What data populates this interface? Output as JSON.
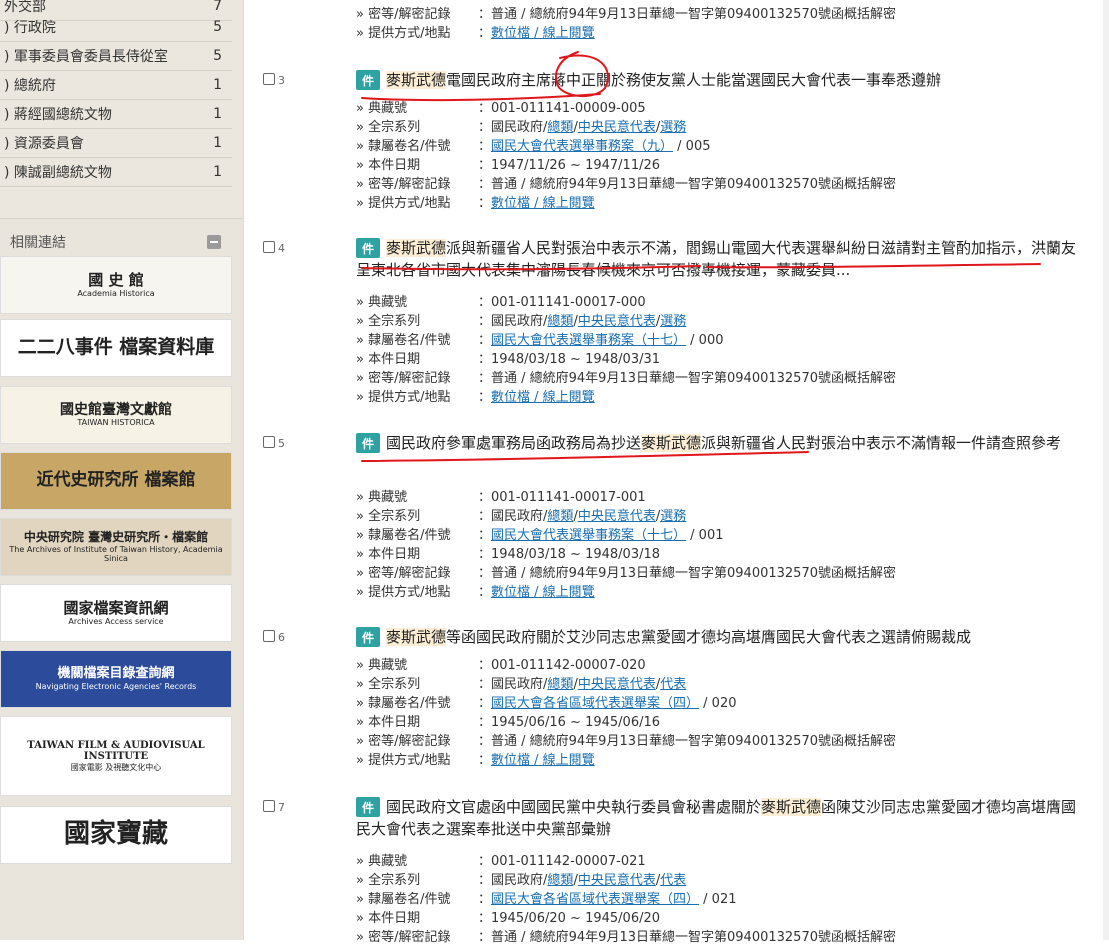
{
  "facets": [
    {
      "label": "外交部",
      "count": "7"
    },
    {
      "label": ") 行政院",
      "count": "5"
    },
    {
      "label": ") 軍事委員會委員長侍從室",
      "count": "5"
    },
    {
      "label": ") 總統府",
      "count": "1"
    },
    {
      "label": ") 蔣經國總統文物",
      "count": "1"
    },
    {
      "label": ") 資源委員會",
      "count": "1"
    },
    {
      "label": ") 陳誠副總統文物",
      "count": "1"
    }
  ],
  "related": {
    "title": "相關連結",
    "banners": [
      {
        "text": "國 史 館",
        "sub": "Academia Historica"
      },
      {
        "text": "二二八事件 檔案資料庫",
        "sub": ""
      },
      {
        "text": "國史館臺灣文獻館",
        "sub": "TAIWAN HISTORICA"
      },
      {
        "text": "近代史研究所 檔案館",
        "sub": ""
      },
      {
        "text": "中央研究院 臺灣史研究所‧檔案館",
        "sub": "The Archives of Institute of Taiwan History, Academia Sinica"
      },
      {
        "text": "國家檔案資訊網",
        "sub": "Archives Access service"
      },
      {
        "text": "機關檔案目錄查詢網",
        "sub": "Navigating Electronic Agencies' Records"
      },
      {
        "text": "TAIWAN FILM & AUDIOVISUAL INSTITUTE",
        "sub": "國家電影 及視聽文化中心"
      },
      {
        "text": "國家寶藏",
        "sub": ""
      }
    ]
  },
  "top_rows": [
    {
      "label": "» 密等/解密記錄",
      "value": "：普通 / 總統府94年9月13日華總一智字第09400132570號函概括解密"
    },
    {
      "label": "» 提供方式/地點",
      "value_pre": "：",
      "link": "數位檔 / 線上閱覽"
    }
  ],
  "results": [
    {
      "num": "3",
      "badge": "件",
      "title_hl": "麥斯武德",
      "title_rest": "電國民政府主席蔣中正關於務使友黨人士能當選國民大會代表一事奉悉遵辦",
      "title_pre": "",
      "ref": "：001-011141-00009-005",
      "series_links": [
        "國民政府",
        "總類",
        "中央民意代表",
        "選務"
      ],
      "volume_link": "國民大會代表選舉事務案（九）",
      "volume_num": " / 005",
      "date": "：1947/11/26 ~ 1947/11/26",
      "secret": "：普通 / 總統府94年9月13日華總一智字第09400132570號函概括解密",
      "access_link": "數位檔 / 線上閱覽"
    },
    {
      "num": "4",
      "badge": "件",
      "title_hl": "麥斯武德",
      "title_rest": "派與新疆省人民對張治中表示不滿，閻錫山電國大代表選舉糾紛日滋請對主管酌加指示，洪蘭友呈東北各省市國大代表集中瀋陽長春候機來京可否撥專機接運，蒙藏委員...",
      "title_pre": "",
      "ref": "：001-011141-00017-000",
      "series_links": [
        "國民政府",
        "總類",
        "中央民意代表",
        "選務"
      ],
      "volume_link": "國民大會代表選舉事務案（十七）",
      "volume_num": " / 000",
      "date": "：1948/03/18 ~ 1948/03/31",
      "secret": "：普通 / 總統府94年9月13日華總一智字第09400132570號函概括解密",
      "access_link": "數位檔 / 線上閱覽"
    },
    {
      "num": "5",
      "badge": "件",
      "title_pre": "國民政府參軍處軍務局函政務局為抄送",
      "title_hl": "麥斯武德",
      "title_rest": "派與新疆省人民對張治中表示不滿情報一件請查照參考",
      "ref": "：001-011141-00017-001",
      "series_links": [
        "國民政府",
        "總類",
        "中央民意代表",
        "選務"
      ],
      "volume_link": "國民大會代表選舉事務案（十七）",
      "volume_num": " / 001",
      "date": "：1948/03/18 ~ 1948/03/18",
      "secret": "：普通 / 總統府94年9月13日華總一智字第09400132570號函概括解密",
      "access_link": "數位檔 / 線上閱覽"
    },
    {
      "num": "6",
      "badge": "件",
      "title_pre": "",
      "title_hl": "麥斯武德",
      "title_rest": "等函國民政府關於艾沙同志忠黨愛國才德均高堪膺國民大會代表之選請俯賜裁成",
      "ref": "：001-011142-00007-020",
      "series_links": [
        "國民政府",
        "總類",
        "中央民意代表",
        "代表"
      ],
      "volume_link": "國民大會各省區域代表選舉案（四）",
      "volume_num": " / 020",
      "date": "：1945/06/16 ~ 1945/06/16",
      "secret": "：普通 / 總統府94年9月13日華總一智字第09400132570號函概括解密",
      "access_link": "數位檔 / 線上閱覽"
    },
    {
      "num": "7",
      "badge": "件",
      "title_pre": "國民政府文官處函中國國民黨中央執行委員會秘書處關於",
      "title_hl": "麥斯武德",
      "title_rest": "函陳艾沙同志忠黨愛國才德均高堪膺國民大會代表之選案奉批送中央黨部彙辦",
      "ref": "：001-011142-00007-021",
      "series_links": [
        "國民政府",
        "總類",
        "中央民意代表",
        "代表"
      ],
      "volume_link": "國民大會各省區域代表選舉案（四）",
      "volume_num": " / 021",
      "date": "：1945/06/20 ~ 1945/06/20",
      "secret": "：普通 / 總統府94年9月13日華總一智字第09400132570號函概括解密",
      "access_link": ""
    }
  ],
  "labels": {
    "ref": "» 典藏號",
    "series": "» 全宗系列",
    "volume": "» 隸屬卷名/件號",
    "date": "» 本件日期",
    "secret": "» 密等/解密記錄",
    "access": "» 提供方式/地點",
    "colon": "："
  },
  "colors": {
    "badge": "#2ea2a2",
    "link": "#1a6fb0",
    "highlight": "#fbeed5",
    "annotation": "#e0161b"
  }
}
